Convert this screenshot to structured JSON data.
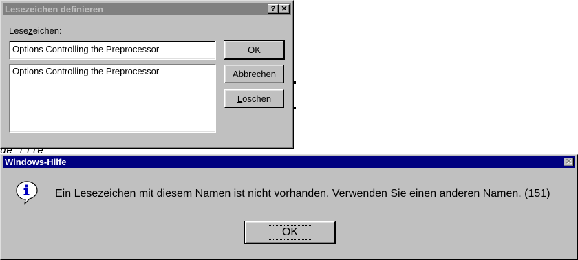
{
  "bookmark_dialog": {
    "title": "Lesezeichen definieren",
    "help_glyph": "?",
    "close_glyph": "✕",
    "label_pre": "Lese",
    "label_accel": "z",
    "label_post": "eichen:",
    "name_value": "Options Controlling the Preprocessor",
    "list_items": [
      "Options Controlling the Preprocessor"
    ],
    "ok_label": "OK",
    "cancel_label": "Abbrechen",
    "delete_accel": "L",
    "delete_rest": "öschen"
  },
  "message_box": {
    "title": "Windows-Hilfe",
    "close_glyph": "✕",
    "icon": "info-icon",
    "message": "Ein Lesezeichen mit diesem Namen ist nicht vorhanden. Verwenden Sie einen anderen Namen. (151)",
    "ok_label": "OK"
  },
  "background": {
    "fragment": "de file"
  }
}
